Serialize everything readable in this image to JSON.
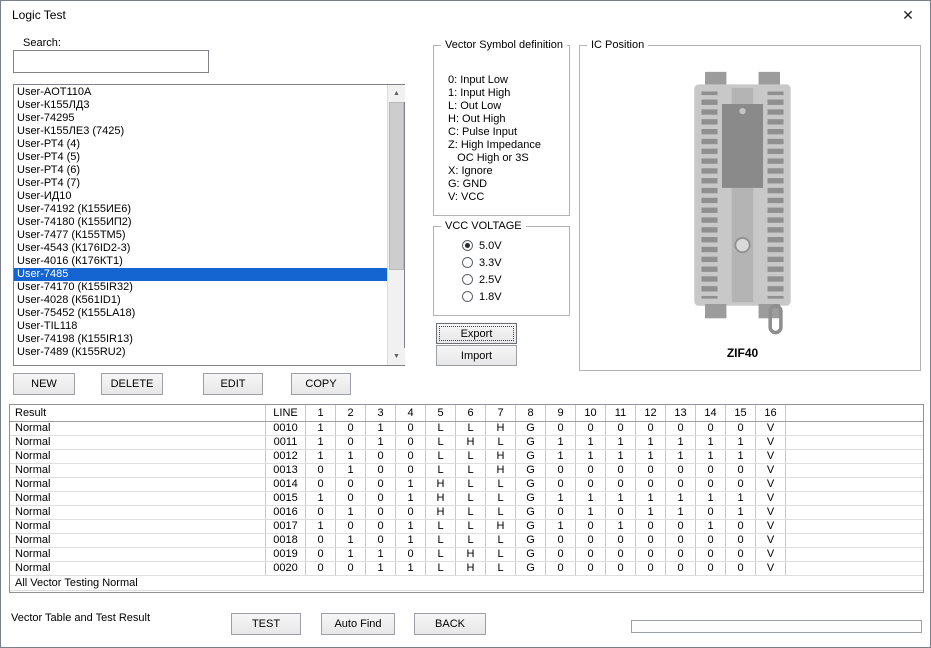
{
  "window": {
    "title": "Logic Test",
    "close_icon": "✕"
  },
  "icons": {
    "scroll_up": "▲",
    "scroll_down": "▼"
  },
  "search": {
    "label": "Search:",
    "value": ""
  },
  "device_list": {
    "items": [
      "User-AOT110A",
      "User-К155ЛД3",
      "User-74295",
      "User-К155ЛЕ3 (7425)",
      "User-РТ4 (4)",
      "User-РТ4 (5)",
      "User-РТ4 (6)",
      "User-РТ4 (7)",
      "User-ИД10",
      "User-74192 (К155ИЕ6)",
      "User-74180 (К155ИП2)",
      "User-7477 (К155ТМ5)",
      "User-4543 (К176ID2-3)",
      "User-4016 (К176КТ1)",
      "User-7485",
      "User-74170 (К155IR32)",
      "User-4028 (К561ID1)",
      "User-75452 (К155LA18)",
      "User-TIL118",
      "User-74198 (К155IR13)",
      "User-7489 (К155RU2)"
    ],
    "selected_index": 14,
    "selected_item": "User-7485"
  },
  "list_buttons": {
    "new": "NEW",
    "delete": "DELETE",
    "edit": "EDIT",
    "copy": "COPY"
  },
  "vector_symbols": {
    "title": "Vector Symbol definition",
    "lines": [
      "0: Input Low",
      "1: Input High",
      "L: Out Low",
      "H: Out High",
      "C: Pulse Input",
      "Z: High Impedance",
      "   OC High or 3S",
      "X: Ignore",
      "G: GND",
      "V: VCC"
    ]
  },
  "vcc_voltage": {
    "title": "VCC VOLTAGE",
    "options": [
      "5.0V",
      "3.3V",
      "2.5V",
      "1.8V"
    ],
    "selected": "5.0V"
  },
  "io_buttons": {
    "export": "Export",
    "import": "Import"
  },
  "ic_position": {
    "title": "IC Position",
    "socket_label": "ZIF40"
  },
  "vector_table": {
    "headers": [
      "Result",
      "LINE",
      "1",
      "2",
      "3",
      "4",
      "5",
      "6",
      "7",
      "8",
      "9",
      "10",
      "11",
      "12",
      "13",
      "14",
      "15",
      "16"
    ],
    "rows": [
      {
        "result": "Normal",
        "line": "0010",
        "values": [
          "1",
          "0",
          "1",
          "0",
          "L",
          "L",
          "H",
          "G",
          "0",
          "0",
          "0",
          "0",
          "0",
          "0",
          "0",
          "V"
        ]
      },
      {
        "result": "Normal",
        "line": "0011",
        "values": [
          "1",
          "0",
          "1",
          "0",
          "L",
          "H",
          "L",
          "G",
          "1",
          "1",
          "1",
          "1",
          "1",
          "1",
          "1",
          "V"
        ]
      },
      {
        "result": "Normal",
        "line": "0012",
        "values": [
          "1",
          "1",
          "0",
          "0",
          "L",
          "L",
          "H",
          "G",
          "1",
          "1",
          "1",
          "1",
          "1",
          "1",
          "1",
          "V"
        ]
      },
      {
        "result": "Normal",
        "line": "0013",
        "values": [
          "0",
          "1",
          "0",
          "0",
          "L",
          "L",
          "H",
          "G",
          "0",
          "0",
          "0",
          "0",
          "0",
          "0",
          "0",
          "V"
        ]
      },
      {
        "result": "Normal",
        "line": "0014",
        "values": [
          "0",
          "0",
          "0",
          "1",
          "H",
          "L",
          "L",
          "G",
          "0",
          "0",
          "0",
          "0",
          "0",
          "0",
          "0",
          "V"
        ]
      },
      {
        "result": "Normal",
        "line": "0015",
        "values": [
          "1",
          "0",
          "0",
          "1",
          "H",
          "L",
          "L",
          "G",
          "1",
          "1",
          "1",
          "1",
          "1",
          "1",
          "1",
          "V"
        ]
      },
      {
        "result": "Normal",
        "line": "0016",
        "values": [
          "0",
          "1",
          "0",
          "0",
          "H",
          "L",
          "L",
          "G",
          "0",
          "1",
          "0",
          "1",
          "1",
          "0",
          "1",
          "V"
        ]
      },
      {
        "result": "Normal",
        "line": "0017",
        "values": [
          "1",
          "0",
          "0",
          "1",
          "L",
          "L",
          "H",
          "G",
          "1",
          "0",
          "1",
          "0",
          "0",
          "1",
          "0",
          "V"
        ]
      },
      {
        "result": "Normal",
        "line": "0018",
        "values": [
          "0",
          "1",
          "0",
          "1",
          "L",
          "L",
          "L",
          "G",
          "0",
          "0",
          "0",
          "0",
          "0",
          "0",
          "0",
          "V"
        ]
      },
      {
        "result": "Normal",
        "line": "0019",
        "values": [
          "0",
          "1",
          "1",
          "0",
          "L",
          "H",
          "L",
          "G",
          "0",
          "0",
          "0",
          "0",
          "0",
          "0",
          "0",
          "V"
        ]
      },
      {
        "result": "Normal",
        "line": "0020",
        "values": [
          "0",
          "0",
          "1",
          "1",
          "L",
          "H",
          "L",
          "G",
          "0",
          "0",
          "0",
          "0",
          "0",
          "0",
          "0",
          "V"
        ]
      }
    ],
    "footer": "All Vector Testing Normal"
  },
  "status": {
    "label": "Vector Table and Test Result"
  },
  "action_buttons": {
    "test": "TEST",
    "auto_find": "Auto Find",
    "back": "BACK"
  },
  "colors": {
    "selection": "#1464d2",
    "socket_gray": "#9c9c9c"
  }
}
